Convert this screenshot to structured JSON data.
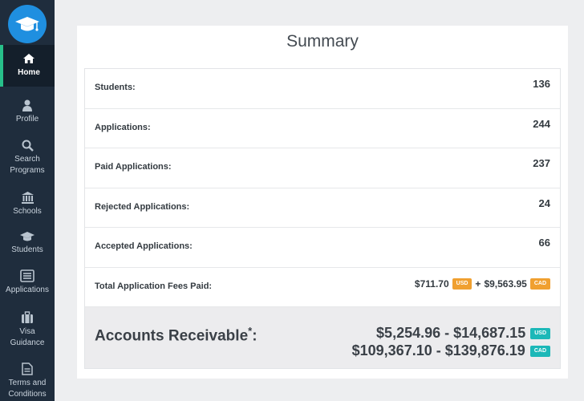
{
  "sidebar": {
    "items": [
      {
        "label": "Home",
        "icon": "home-icon"
      },
      {
        "label": "Profile",
        "icon": "user-icon"
      },
      {
        "label": "Search Programs",
        "icon": "search-icon"
      },
      {
        "label": "Schools",
        "icon": "school-icon"
      },
      {
        "label": "Students",
        "icon": "graduation-cap-icon"
      },
      {
        "label": "Applications",
        "icon": "list-icon"
      },
      {
        "label": "Visa Guidance",
        "icon": "suitcase-icon"
      },
      {
        "label": "Terms and Conditions",
        "icon": "document-icon"
      }
    ]
  },
  "summary": {
    "title": "Summary",
    "rows": [
      {
        "label": "Students:",
        "value": "136"
      },
      {
        "label": "Applications:",
        "value": "244"
      },
      {
        "label": "Paid Applications:",
        "value": "237"
      },
      {
        "label": "Rejected Applications:",
        "value": "24"
      },
      {
        "label": "Accepted Applications:",
        "value": "66"
      }
    ],
    "fees": {
      "label": "Total Application Fees Paid:",
      "usd_amount": "$711.70",
      "usd_tag": "USD",
      "plus": "+",
      "cad_amount": "$9,563.95",
      "cad_tag": "CAD"
    },
    "accounts_receivable": {
      "label": "Accounts Receivable",
      "mark": "*",
      "colon": ":",
      "usd_range": "$5,254.96 - $14,687.15",
      "usd_tag": "USD",
      "cad_range": "$109,367.10 - $139,876.19",
      "cad_tag": "CAD"
    }
  },
  "colors": {
    "sidebar_bg": "#1f2d3d",
    "active_indicator": "#27c08a",
    "logo_bg": "#1f8fe0",
    "badge_usd_fees": "#f0a030",
    "badge_teal": "#1cb8b8"
  }
}
